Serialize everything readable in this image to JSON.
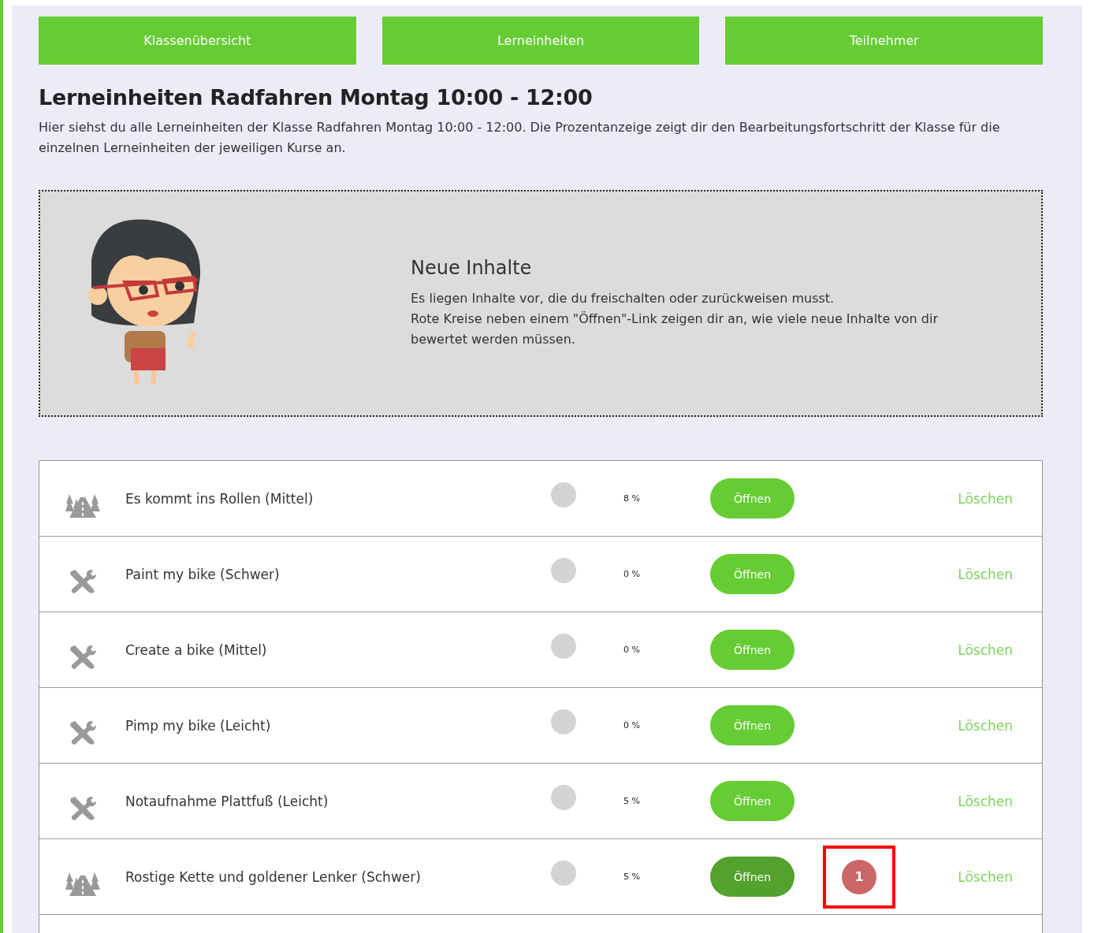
{
  "nav": [
    {
      "label": "Klassenübersicht",
      "selected": false
    },
    {
      "label": "Lerneinheiten",
      "selected": false
    },
    {
      "label": "Teilnehmer",
      "selected": false
    }
  ],
  "heading": "Lerneinheiten Radfahren Montag 10:00 - 12:00",
  "intro": "Hier siehst du alle Lerneinheiten der Klasse Radfahren Montag 10:00 - 12:00. Die Prozentanzeige zeigt dir den Bearbeitungsfortschritt der Klasse für die einzelnen Lerneinheiten der jeweiligen Kurse an.",
  "notice": {
    "title": "Neue Inhalte",
    "lines": [
      "Es liegen Inhalte vor, die du freischalten oder zurückweisen musst.",
      "Rote Kreise neben einem \"Öffnen\"-Link zeigen dir an, wie viele neue Inhalte von dir bewertet werden müssen."
    ]
  },
  "units": [
    {
      "kind": "road",
      "title": "Es kommt ins Rollen (Mittel)",
      "percent": "8 %",
      "open": "Öffnen",
      "open_active": false,
      "delete": "Löschen"
    },
    {
      "kind": "tools",
      "title": "Paint my bike (Schwer)",
      "percent": "0 %",
      "open": "Öffnen",
      "open_active": false,
      "delete": "Löschen"
    },
    {
      "kind": "tools",
      "title": "Create a bike (Mittel)",
      "percent": "0 %",
      "open": "Öffnen",
      "open_active": false,
      "delete": "Löschen"
    },
    {
      "kind": "tools",
      "title": "Pimp my bike (Leicht)",
      "percent": "0 %",
      "open": "Öffnen",
      "open_active": false,
      "delete": "Löschen"
    },
    {
      "kind": "tools",
      "title": "Notaufnahme Plattfuß (Leicht)",
      "percent": "5 %",
      "open": "Öffnen",
      "open_active": false,
      "delete": "Löschen"
    },
    {
      "kind": "road",
      "title": "Rostige Kette und goldener Lenker (Schwer)",
      "percent": "5 %",
      "open": "Öffnen",
      "open_active": true,
      "badge": {
        "count": "1",
        "highlighted": true
      },
      "delete": "Löschen"
    }
  ]
}
